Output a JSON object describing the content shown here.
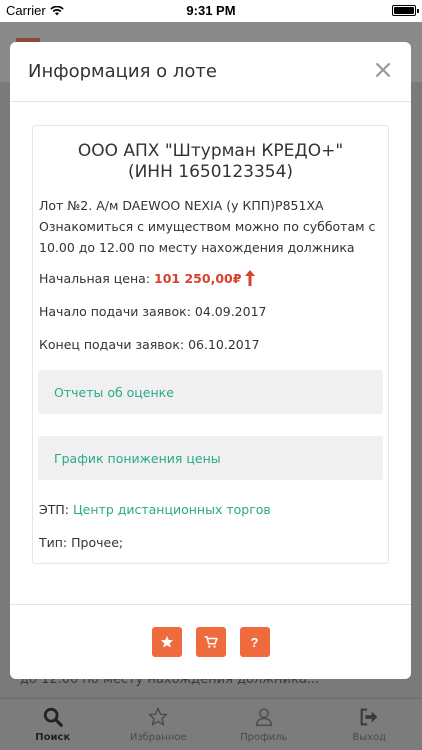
{
  "status": {
    "carrier": "Carrier",
    "time": "9:31 PM"
  },
  "modal": {
    "title": "Информация о лоте",
    "close": "×",
    "lot_title_line1": "ООО АПХ \"Штурман КРЕДО+\"",
    "lot_title_line2": "(ИНН 1650123354)",
    "description": "Лот №2. А/м DAEWOO NEXIA (у КПП)Р851ХА Ознакомиться с имуществом можно по субботам с 10.00 до 12.00 по месту нахождения должника",
    "start_price_label": "Начальная цена:",
    "start_price_value": "101 250,00₽",
    "start_label": "Начало подачи заявок:",
    "start_date": "04.09.2017",
    "end_label": "Конец подачи заявок:",
    "end_date": "06.10.2017",
    "panel_reports": "Отчеты об оценке",
    "panel_schedule": "График понижения цены",
    "etp_label": "ЭТП:",
    "etp_link": "Центр дистанционных торгов",
    "type_label": "Тип:",
    "type_value": "Прочее;",
    "help_label": "?"
  },
  "background": {
    "text": "до 12.00 по месту нахождения должника..."
  },
  "tabs": [
    {
      "label": "Поиск",
      "icon": "search-icon",
      "active": true
    },
    {
      "label": "Избранное",
      "icon": "star-icon",
      "active": false
    },
    {
      "label": "Профиль",
      "icon": "user-icon",
      "active": false
    },
    {
      "label": "Выход",
      "icon": "exit-icon",
      "active": false
    }
  ],
  "colors": {
    "accent": "#ef6a3c",
    "price": "#d9412f",
    "link": "#2aa88a"
  }
}
